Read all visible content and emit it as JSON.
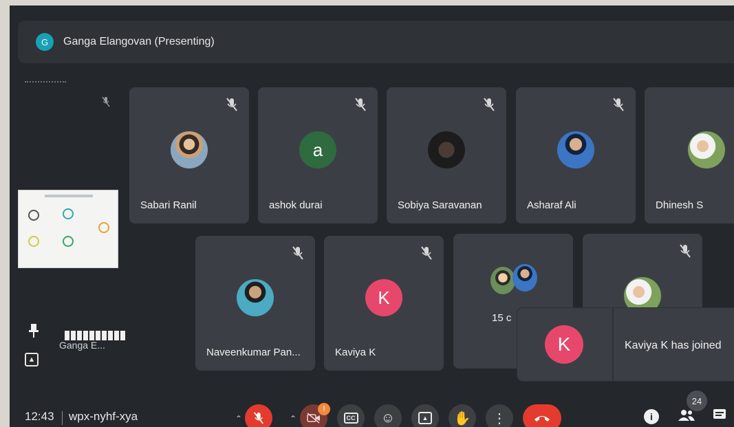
{
  "header": {
    "presenter_initial": "G",
    "title": "Ganga Elangovan (Presenting)"
  },
  "left_panel": {
    "self_name": "Ganga E..."
  },
  "participants_row1": [
    {
      "name": "Sabari Ranil",
      "avatar_type": "photo",
      "muted": true
    },
    {
      "name": "ashok durai",
      "avatar_letter": "a",
      "avatar_color": "#2e6b3f",
      "muted": true
    },
    {
      "name": "Sobiya Saravanan",
      "avatar_type": "photo",
      "muted": true
    },
    {
      "name": "Asharaf Ali",
      "avatar_type": "photo",
      "muted": true
    },
    {
      "name": "Dhinesh S",
      "avatar_type": "photo",
      "muted": false
    }
  ],
  "participants_row2": [
    {
      "name": "Naveenkumar Pan...",
      "avatar_type": "photo",
      "muted": true
    },
    {
      "name": "Kaviya K",
      "avatar_letter": "K",
      "avatar_color": "#e8476c",
      "muted": true
    },
    {
      "name": "15 c",
      "avatar_type": "group",
      "muted": false
    },
    {
      "name": "",
      "avatar_type": "photo",
      "muted": true
    }
  ],
  "toast": {
    "avatar_letter": "K",
    "avatar_color": "#e8476c",
    "message": "Kaviya K has joined"
  },
  "bottom_bar": {
    "time": "12:43",
    "meeting_code": "wpx-nyhf-xya",
    "camera_badge": "!",
    "participant_count": "24",
    "controls": [
      "mic-off",
      "camera-off",
      "captions",
      "emoji",
      "present",
      "raise-hand",
      "more",
      "end-call"
    ],
    "right_icons": [
      "info",
      "people",
      "chat"
    ]
  },
  "colors": {
    "background": "#24272b",
    "tile": "#3b3f45",
    "danger": "#e33b2e",
    "accent": "#18a0b5"
  }
}
